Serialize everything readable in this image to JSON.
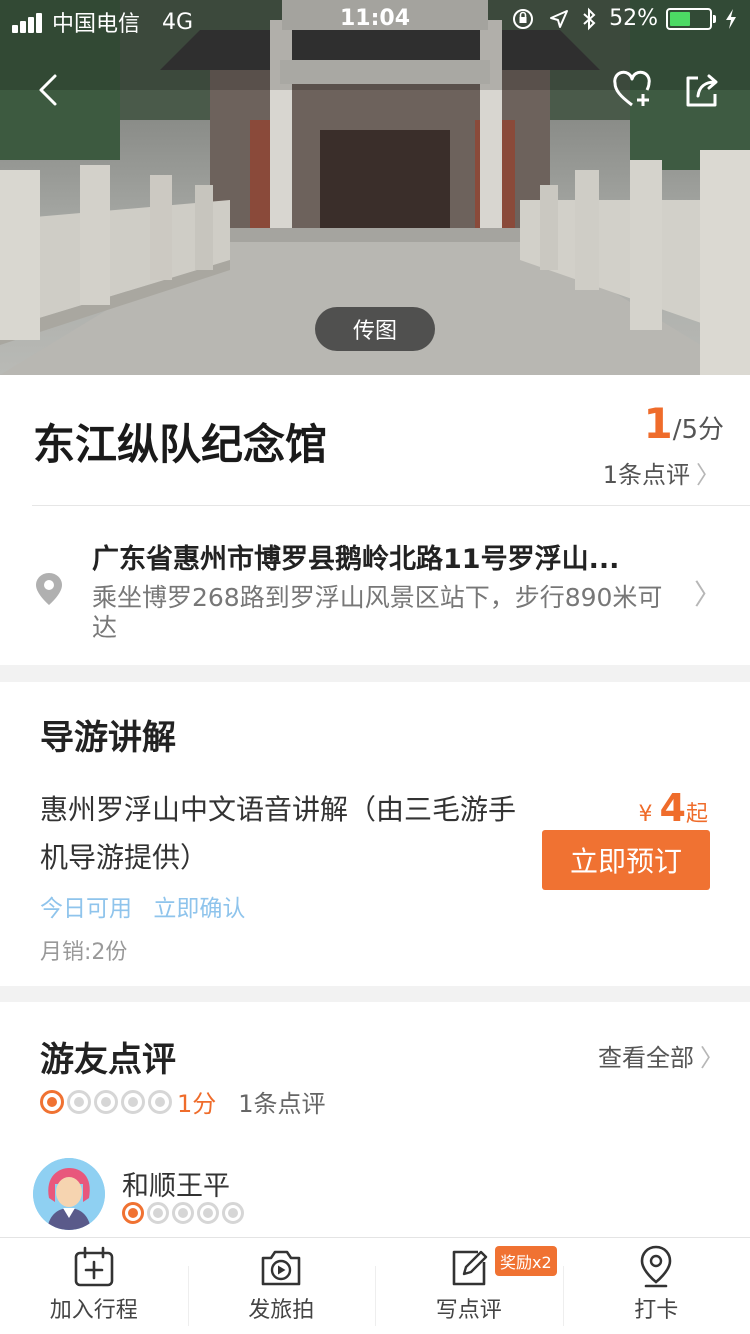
{
  "status_bar": {
    "carrier": "中国电信",
    "network": "4G",
    "time": "11:04",
    "battery": "52%",
    "battery_level": 0.52
  },
  "hero": {
    "upload_photo_label": "传图",
    "icons": [
      "back-icon",
      "favorite-add-icon",
      "share-icon"
    ]
  },
  "poi": {
    "name": "东江纵队纪念馆",
    "score": "1",
    "score_suffix": "/5分",
    "review_count_link": "1条点评",
    "address": "广东省惠州市博罗县鹅岭北路11号罗浮山...",
    "directions": "乘坐博罗268路到罗浮山风景区站下，步行890米可达"
  },
  "guide": {
    "section_title": "导游讲解",
    "product_name": "惠州罗浮山中文语音讲解（由三毛游手机导游提供）",
    "currency": "¥",
    "price": "4",
    "price_suffix": "起",
    "book_button": "立即预订",
    "tags": [
      "今日可用",
      "立即确认"
    ],
    "monthly_sales": "月销:2份"
  },
  "reviews": {
    "section_title": "游友点评",
    "see_all": "查看全部",
    "rating_text": "1分",
    "rating_value": 1,
    "rating_max": 5,
    "review_count": "1条点评",
    "first_review": {
      "user_name": "和顺王平",
      "rating_value": 1
    }
  },
  "tabbar": {
    "items": [
      {
        "label": "加入行程",
        "icon": "calendar-add-icon"
      },
      {
        "label": "发旅拍",
        "icon": "camera-video-icon"
      },
      {
        "label": "写点评",
        "icon": "edit-review-icon",
        "badge": "奖励x2"
      },
      {
        "label": "打卡",
        "icon": "location-pin-icon"
      }
    ]
  },
  "colors": {
    "accent": "#f07232",
    "tag_blue": "#8fc4ec",
    "battery_green": "#4cd964"
  }
}
